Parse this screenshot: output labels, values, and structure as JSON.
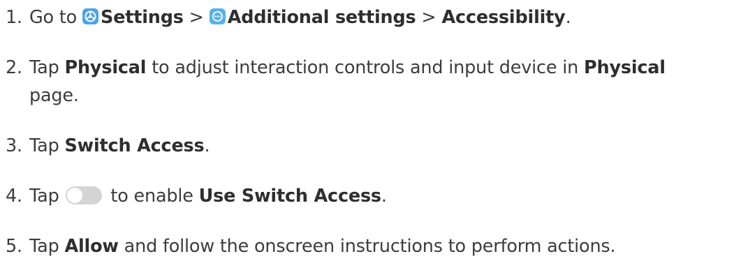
{
  "steps": [
    {
      "num": "1.",
      "pre": "Go to ",
      "settings": "Settings",
      "sep1": " > ",
      "additional": "Additional settings",
      "sep2": " > ",
      "accessibility": "Accessibility",
      "end": ".",
      "icons": [
        "settings-icon",
        "more-icon"
      ]
    },
    {
      "num": "2.",
      "pre": "Tap ",
      "physical": "Physical",
      "mid": " to adjust interaction controls and input device in ",
      "physical2": "Physical",
      "cont": "page."
    },
    {
      "num": "3.",
      "pre": "Tap ",
      "switch_access": "Switch Access",
      "end": "."
    },
    {
      "num": "4.",
      "pre": "Tap ",
      "mid": " to enable ",
      "use_switch_access": "Use Switch Access",
      "end": ".",
      "toggle_state": "off"
    },
    {
      "num": "5.",
      "pre": "Tap ",
      "allow": "Allow",
      "post": " and follow the onscreen instructions to perform actions."
    }
  ],
  "colors": {
    "text": "#3c3c3c",
    "settings_icon": "#4aa3e8",
    "more_icon": "#5ab0e8",
    "toggle_off": "#d4d4d4"
  }
}
